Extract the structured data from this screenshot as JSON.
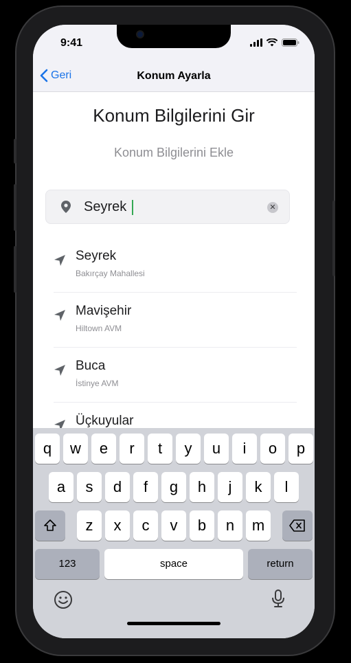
{
  "status_bar": {
    "time": "9:41"
  },
  "nav": {
    "back_label": "Geri",
    "title": "Konum Ayarla"
  },
  "page": {
    "title": "Konum Bilgilerini Gir",
    "subtitle": "Konum Bilgilerini Ekle"
  },
  "search": {
    "value": "Seyrek"
  },
  "results": [
    {
      "name": "Seyrek",
      "sub": "Bakırçay Mahallesi"
    },
    {
      "name": "Mavişehir",
      "sub": "Hiltown AVM"
    },
    {
      "name": "Buca",
      "sub": "İstinye AVM"
    },
    {
      "name": "Üçkuyular",
      "sub": ""
    }
  ],
  "keyboard": {
    "row1": [
      "q",
      "w",
      "e",
      "r",
      "t",
      "y",
      "u",
      "i",
      "o",
      "p"
    ],
    "row2": [
      "a",
      "s",
      "d",
      "f",
      "g",
      "h",
      "j",
      "k",
      "l"
    ],
    "row3": [
      "z",
      "x",
      "c",
      "v",
      "b",
      "n",
      "m"
    ],
    "numbers_label": "123",
    "space_label": "space",
    "return_label": "return"
  },
  "colors": {
    "accent": "#1a73e8",
    "caret": "#34a853"
  }
}
